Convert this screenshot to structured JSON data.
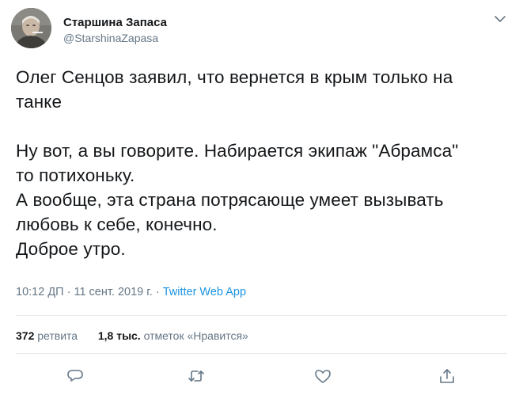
{
  "author": {
    "display_name": "Старшина Запаса",
    "handle": "@StarshinaZapasa",
    "avatar_icon": "profile-photo"
  },
  "menu_icon": "chevron-down-icon",
  "tweet": {
    "lines_para1": [
      "Олег Сенцов заявил, что вернется в крым только на",
      "танке"
    ],
    "lines_para2": [
      "Ну вот, а вы говорите. Набирается экипаж \"Абрамса\"",
      "то потихоньку.",
      "А вообще, эта страна потрясающе умеет вызывать",
      "любовь к себе, конечно.",
      "Доброе утро."
    ]
  },
  "meta": {
    "time": "10:12 ДП",
    "separator": "·",
    "date": "11 сент. 2019 г.",
    "source": "Twitter Web App"
  },
  "stats": {
    "retweets_count": "372",
    "retweets_label": "ретвита",
    "likes_count": "1,8 тыс.",
    "likes_label": "отметок «Нравится»"
  },
  "actions": {
    "reply_icon": "reply-icon",
    "retweet_icon": "retweet-icon",
    "like_icon": "heart-icon",
    "share_icon": "share-icon"
  },
  "colors": {
    "text": "#14171a",
    "secondary": "#657786",
    "link": "#1b95e0",
    "divider": "#e6ecf0"
  }
}
